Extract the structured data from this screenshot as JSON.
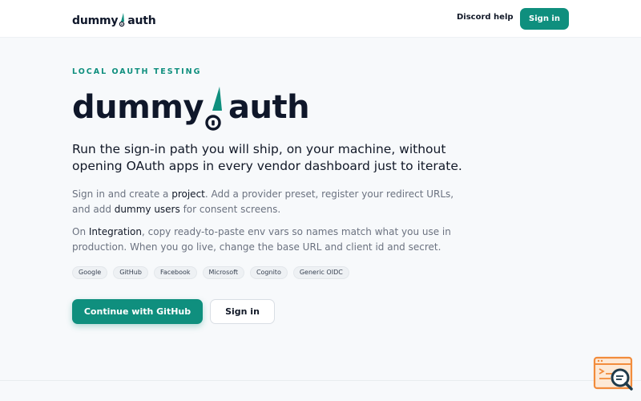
{
  "header": {
    "logo_left": "dummy",
    "logo_right": "auth",
    "discord_label": "Discord help",
    "signin_label": "Sign in"
  },
  "hero": {
    "eyebrow": "LOCAL OAUTH TESTING",
    "title_left": "dummy",
    "title_right": "auth",
    "lead": "Run the sign-in path you will ship, on your machine, without opening OAuth apps in every vendor dashboard just to iterate.",
    "p1": {
      "t1": "Sign in and create a ",
      "link1": "project",
      "t2": ". Add a provider preset, register your redirect URLs, and add ",
      "link2": "dummy users",
      "t3": " for consent screens."
    },
    "p2": {
      "t1": "On ",
      "link1": "Integration",
      "t2": ", copy ready-to-paste env vars so names match what you use in production. When you go live, change the base URL and client id and secret."
    },
    "providers": [
      "Google",
      "GitHub",
      "Facebook",
      "Microsoft",
      "Cognito",
      "Generic OIDC"
    ],
    "cta_primary": "Continue with GitHub",
    "cta_secondary": "Sign in"
  },
  "icons": {
    "brand_mark": "key-flame-icon",
    "widget": "search-feedback-icon"
  },
  "colors": {
    "accent": "#0f8f7e",
    "text": "#0f172a",
    "muted": "#6b7280",
    "background": "#f7f9fb",
    "widget": "#f28c3c"
  }
}
